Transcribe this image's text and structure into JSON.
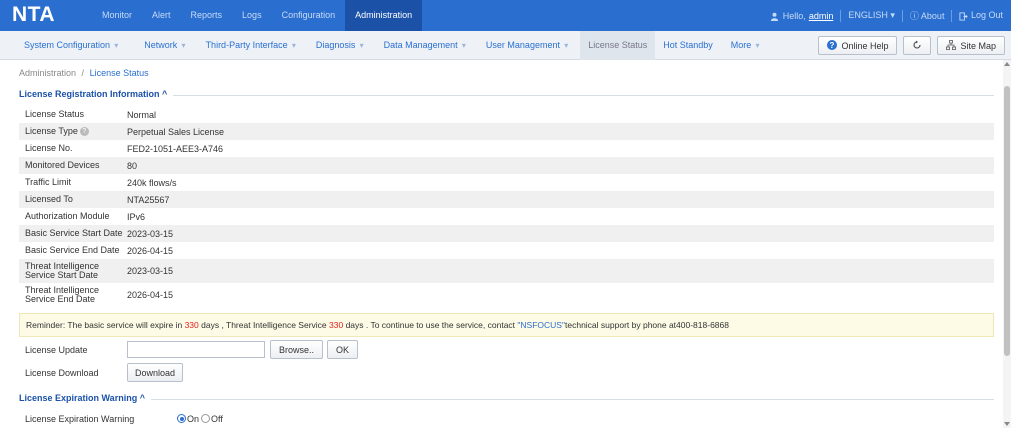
{
  "app": {
    "logo": "NTA"
  },
  "top_nav": [
    {
      "label": "Monitor"
    },
    {
      "label": "Alert"
    },
    {
      "label": "Reports"
    },
    {
      "label": "Logs"
    },
    {
      "label": "Configuration"
    },
    {
      "label": "Administration",
      "active": true
    }
  ],
  "user_menu": {
    "hello": "Hello,",
    "username": "admin",
    "language": "ENGLISH",
    "about": "About",
    "logout": "Log Out"
  },
  "sub_nav": [
    {
      "label": "System Configuration",
      "dropdown": true
    },
    {
      "label": "Network",
      "dropdown": true
    },
    {
      "label": "Third-Party Interface",
      "dropdown": true
    },
    {
      "label": "Diagnosis",
      "dropdown": true
    },
    {
      "label": "Data Management",
      "dropdown": true
    },
    {
      "label": "User Management",
      "dropdown": true
    },
    {
      "label": "License Status",
      "dropdown": false,
      "active": true
    },
    {
      "label": "Hot Standby",
      "dropdown": false
    },
    {
      "label": "More",
      "dropdown": true
    }
  ],
  "toolbar": {
    "online_help": "Online Help",
    "site_map": "Site Map"
  },
  "breadcrumb": {
    "parent": "Administration",
    "separator": "/",
    "current": "License Status"
  },
  "section_registration": {
    "title": "License Registration Information"
  },
  "license_info": [
    {
      "key": "License Status",
      "value": "Normal"
    },
    {
      "key": "License Type",
      "value": "Perpetual Sales License",
      "help_icon": true
    },
    {
      "key": "License No.",
      "value": "FED2-1051-AEE3-A746"
    },
    {
      "key": "Monitored Devices",
      "value": "80"
    },
    {
      "key": "Traffic Limit",
      "value": "240k flows/s"
    },
    {
      "key": "Licensed To",
      "value": "NTA25567"
    },
    {
      "key": "Authorization Module",
      "value": "IPv6"
    },
    {
      "key": "Basic Service Start Date",
      "value": "2023-03-15"
    },
    {
      "key": "Basic Service End Date",
      "value": "2026-04-15"
    },
    {
      "key": "Threat Intelligence Service Start Date",
      "value": "2023-03-15"
    },
    {
      "key": "Threat Intelligence Service End Date",
      "value": "2026-04-15"
    }
  ],
  "reminder": {
    "part1": "Reminder: The basic service will expire in ",
    "basic_days": "330",
    "part2": " days , Threat Intelligence Service ",
    "ti_days": "330",
    "part3": " days . To continue to use the service, contact ",
    "company": "\"NSFOCUS\"",
    "part4": "technical support by phone at400-818-6868"
  },
  "license_update": {
    "label": "License Update",
    "browse": "Browse..",
    "ok": "OK"
  },
  "license_download": {
    "label": "License Download",
    "button": "Download"
  },
  "section_expiration": {
    "title": "License Expiration Warning"
  },
  "expiration_warning": {
    "label": "License Expiration Warning",
    "on": "On",
    "off": "Off",
    "selected": "On"
  },
  "colors": {
    "topbar": "#2a6fd0",
    "active_tab": "#1b52a8",
    "link": "#2a6fd0",
    "alert_red": "#e02020"
  }
}
